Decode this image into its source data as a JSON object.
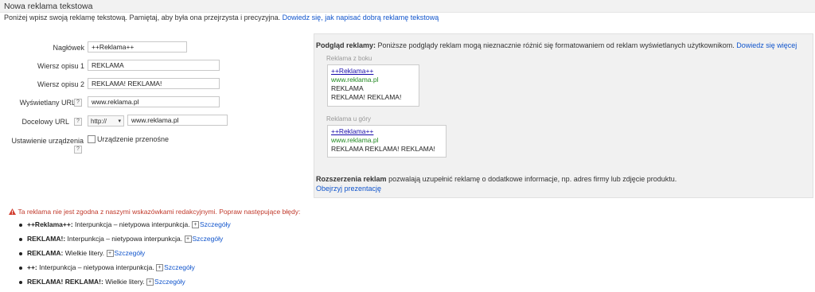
{
  "header": {
    "title": "Nowa reklama tekstowa",
    "intro": "Poniżej wpisz swoją reklamę tekstową. Pamiętaj, aby była ona przejrzysta i precyzyjna.",
    "intro_link": "Dowiedz się, jak napisać dobrą reklamę tekstową"
  },
  "form": {
    "headline_label": "Nagłówek",
    "headline_value": "++Reklama++",
    "desc1_label": "Wiersz opisu 1",
    "desc1_value": "REKLAMA",
    "desc2_label": "Wiersz opisu 2",
    "desc2_value": "REKLAMA! REKLAMA!",
    "display_url_label": "Wyświetlany URL",
    "display_url_value": "www.reklama.pl",
    "dest_url_label": "Docelowy URL",
    "dest_protocol": "http://",
    "dest_url_value": "www.reklama.pl",
    "device_label": "Ustawienie urządzenia",
    "device_option": "Urządzenie przenośne",
    "help_glyph": "?"
  },
  "preview": {
    "heading_bold": "Podgląd reklamy:",
    "heading_text": "Poniższe podglądy reklam mogą nieznacznie różnić się formatowaniem od reklam wyświetlanych użytkownikom.",
    "heading_link": "Dowiedz się więcej",
    "side_label": "Reklama z boku",
    "top_label": "Reklama u góry",
    "ad_title": "++Reklama++",
    "ad_url": "www.reklama.pl",
    "ad_line1": "REKLAMA",
    "ad_line2": "REKLAMA! REKLAMA!",
    "ad_top_desc": "REKLAMA REKLAMA! REKLAMA!",
    "ext_bold": "Rozszerzenia reklam",
    "ext_text": "pozwalają uzupełnić reklamę o dodatkowe informacje, np. adres firmy lub zdjęcie produktu.",
    "ext_link": "Obejrzyj prezentację"
  },
  "errors": {
    "warning_icon": "warning-icon",
    "warning_text": "Ta reklama nie jest zgodna z naszymi wskazówkami redakcyjnymi. Popraw następujące błędy:",
    "details_label": "Szczegóły",
    "plus_glyph": "+",
    "items": [
      {
        "term": "++Reklama++:",
        "text": "Interpunkcja – nietypowa interpunkcja."
      },
      {
        "term": "REKLAMA!:",
        "text": "Interpunkcja – nietypowa interpunkcja."
      },
      {
        "term": "REKLAMA:",
        "text": "Wielkie litery."
      },
      {
        "term": "++:",
        "text": "Interpunkcja – nietypowa interpunkcja."
      },
      {
        "term": "REKLAMA! REKLAMA!:",
        "text": "Wielkie litery."
      }
    ]
  }
}
